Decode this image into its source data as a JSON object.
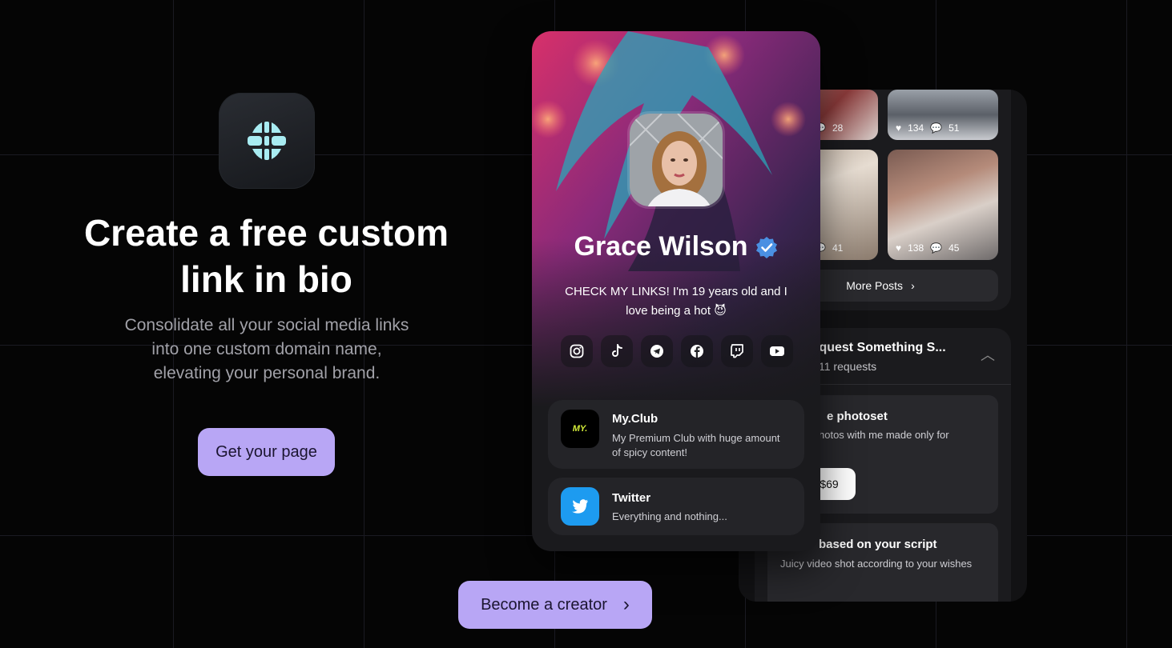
{
  "hero": {
    "title_line1": "Create a free custom",
    "title_line2": "link in bio",
    "subtitle": "Consolidate all your social media links into one custom domain name, elevating your personal brand.",
    "cta": "Get your page"
  },
  "footer_cta": {
    "label": "Become a creator",
    "icon": "chevron-right-icon"
  },
  "profile": {
    "name": "Grace Wilson",
    "verified_icon": "verified-badge-icon",
    "bio": "CHECK MY LINKS! I'm 19 years old and I love being a hot 😈",
    "socials": [
      "instagram-icon",
      "tiktok-icon",
      "telegram-icon",
      "facebook-icon",
      "twitch-icon",
      "youtube-icon"
    ],
    "links": [
      {
        "title": "My.Club",
        "desc": "My Premium Club with huge amount of spicy content!",
        "logo": "MY."
      },
      {
        "title": "Twitter",
        "desc": "Everything and nothing..."
      }
    ]
  },
  "gallery": {
    "posts": [
      {
        "likes": "",
        "comments": "28"
      },
      {
        "likes": "134",
        "comments": "51"
      },
      {
        "likes": "",
        "comments": "41"
      },
      {
        "likes": "138",
        "comments": "45"
      }
    ],
    "more_label": "More Posts"
  },
  "requests": {
    "title": "Request Something S...",
    "count": "11 requests",
    "item1_title": "e photoset",
    "item1_desc": "hotos with me made only for",
    "item1_price": "$69",
    "item2_title": "based on your script",
    "item2_desc": "Juicy video shot according to your wishes"
  },
  "colors": {
    "accent": "#b8a6f5",
    "twitter": "#1d9bf0",
    "verified": "#4a90e2"
  }
}
